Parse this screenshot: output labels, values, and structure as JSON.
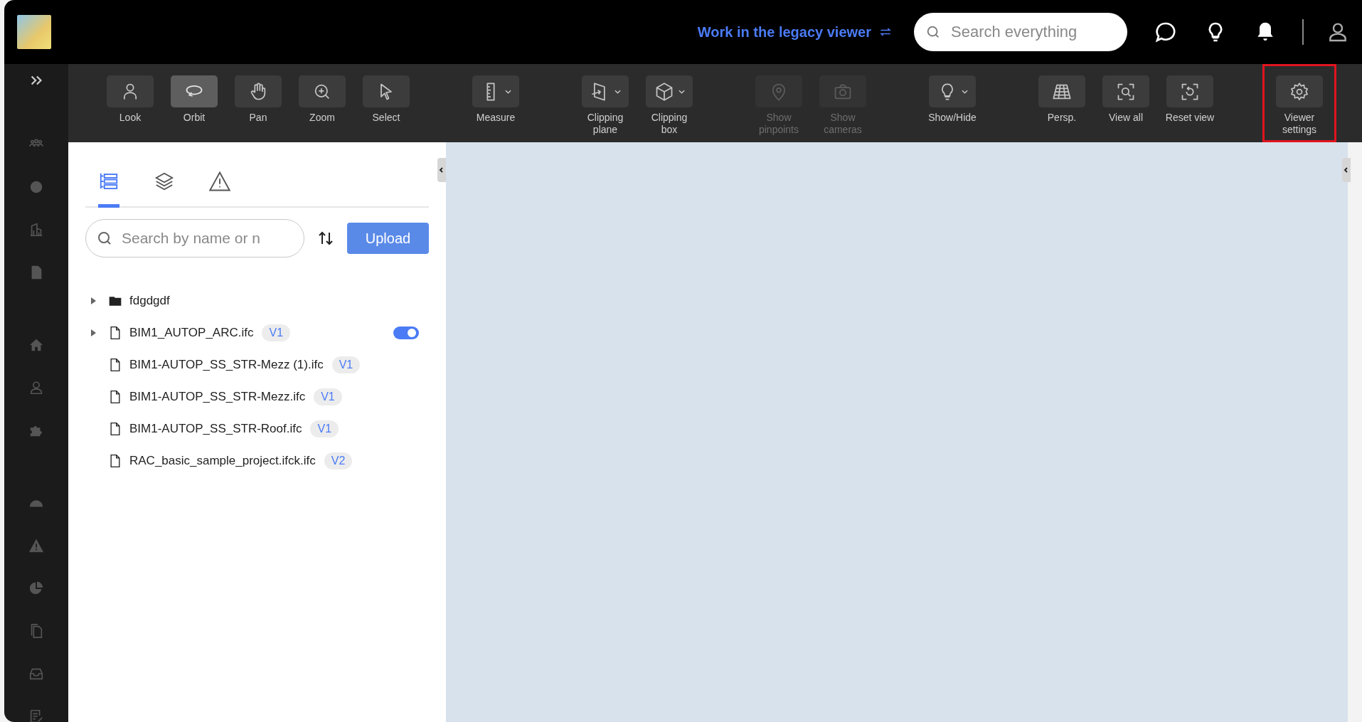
{
  "top_bar": {
    "legacy_link": "Work in the legacy viewer",
    "search": {
      "placeholder": "Search everything"
    }
  },
  "toolbar": {
    "groups": [
      {
        "items": [
          {
            "label": "Look",
            "selected": false,
            "disabled": false,
            "dropdown": false,
            "highlighted": false
          },
          {
            "label": "Orbit",
            "selected": true,
            "disabled": false,
            "dropdown": false,
            "highlighted": false
          },
          {
            "label": "Pan",
            "selected": false,
            "disabled": false,
            "dropdown": false,
            "highlighted": false
          },
          {
            "label": "Zoom",
            "selected": false,
            "disabled": false,
            "dropdown": false,
            "highlighted": false
          },
          {
            "label": "Select",
            "selected": false,
            "disabled": false,
            "dropdown": false,
            "highlighted": false
          }
        ]
      },
      {
        "items": [
          {
            "label": "Measure",
            "selected": false,
            "disabled": false,
            "dropdown": true,
            "highlighted": false
          }
        ]
      },
      {
        "items": [
          {
            "label": "Clipping plane",
            "selected": false,
            "disabled": false,
            "dropdown": true,
            "highlighted": false
          },
          {
            "label": "Clipping box",
            "selected": false,
            "disabled": false,
            "dropdown": true,
            "highlighted": false
          }
        ]
      },
      {
        "items": [
          {
            "label": "Show pinpoints",
            "selected": false,
            "disabled": true,
            "dropdown": false,
            "highlighted": false
          },
          {
            "label": "Show cameras",
            "selected": false,
            "disabled": true,
            "dropdown": false,
            "highlighted": false
          }
        ]
      },
      {
        "items": [
          {
            "label": "Show/Hide",
            "selected": false,
            "disabled": false,
            "dropdown": true,
            "highlighted": false
          }
        ]
      },
      {
        "items": [
          {
            "label": "Persp.",
            "selected": false,
            "disabled": false,
            "dropdown": false,
            "highlighted": false
          },
          {
            "label": "View all",
            "selected": false,
            "disabled": false,
            "dropdown": false,
            "highlighted": false
          },
          {
            "label": "Reset view",
            "selected": false,
            "disabled": false,
            "dropdown": false,
            "highlighted": false
          }
        ]
      },
      {
        "items": [
          {
            "label": "Viewer settings",
            "selected": false,
            "disabled": false,
            "dropdown": false,
            "highlighted": true
          }
        ]
      }
    ]
  },
  "panel": {
    "tabs": [
      {
        "selected": true
      },
      {
        "selected": false
      },
      {
        "selected": false
      }
    ],
    "search": {
      "placeholder": "Search by name or n"
    },
    "upload_button": "Upload",
    "tree": [
      {
        "kind": "folder",
        "name": "fdgdgdf",
        "expandable": true,
        "expanded": false
      },
      {
        "kind": "file",
        "name": "BIM1_AUTOP_ARC.ifc",
        "version": "V1",
        "expandable": true,
        "expanded": false,
        "visible": true
      },
      {
        "kind": "file",
        "name": "BIM1-AUTOP_SS_STR-Mezz (1).ifc",
        "version": "V1",
        "expandable": false
      },
      {
        "kind": "file",
        "name": "BIM1-AUTOP_SS_STR-Mezz.ifc",
        "version": "V1",
        "expandable": false
      },
      {
        "kind": "file",
        "name": "BIM1-AUTOP_SS_STR-Roof.ifc",
        "version": "V1",
        "expandable": false
      },
      {
        "kind": "file",
        "name": "RAC_basic_sample_project.ifck.ifc",
        "version": "V2",
        "expandable": false
      }
    ]
  }
}
